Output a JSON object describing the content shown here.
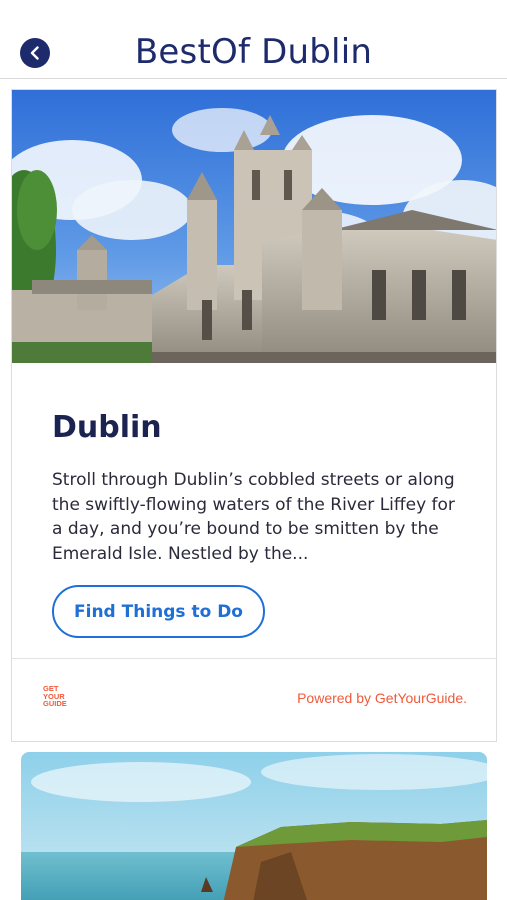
{
  "header": {
    "title": "BestOf Dublin",
    "back_icon": "chevron-left-icon"
  },
  "card": {
    "image_alt": "Christ Church Cathedral, Dublin",
    "title": "Dublin",
    "description": "Stroll through Dublin’s cobbled streets or along the swiftly-flowing waters of the River Liffey for a day, and you’re bound to be smitten by the Emerald Isle. Nestled by the...",
    "cta_label": "Find Things to Do",
    "logo_lines": [
      "GET",
      "YOUR",
      "GUIDE"
    ],
    "powered_by": "Powered by GetYourGuide."
  },
  "next_card": {
    "image_alt": "Cliffs of Moher"
  },
  "colors": {
    "brand_navy": "#1d2a6b",
    "cta_blue": "#1f6fd6",
    "gyg_orange": "#ef5a3c"
  }
}
